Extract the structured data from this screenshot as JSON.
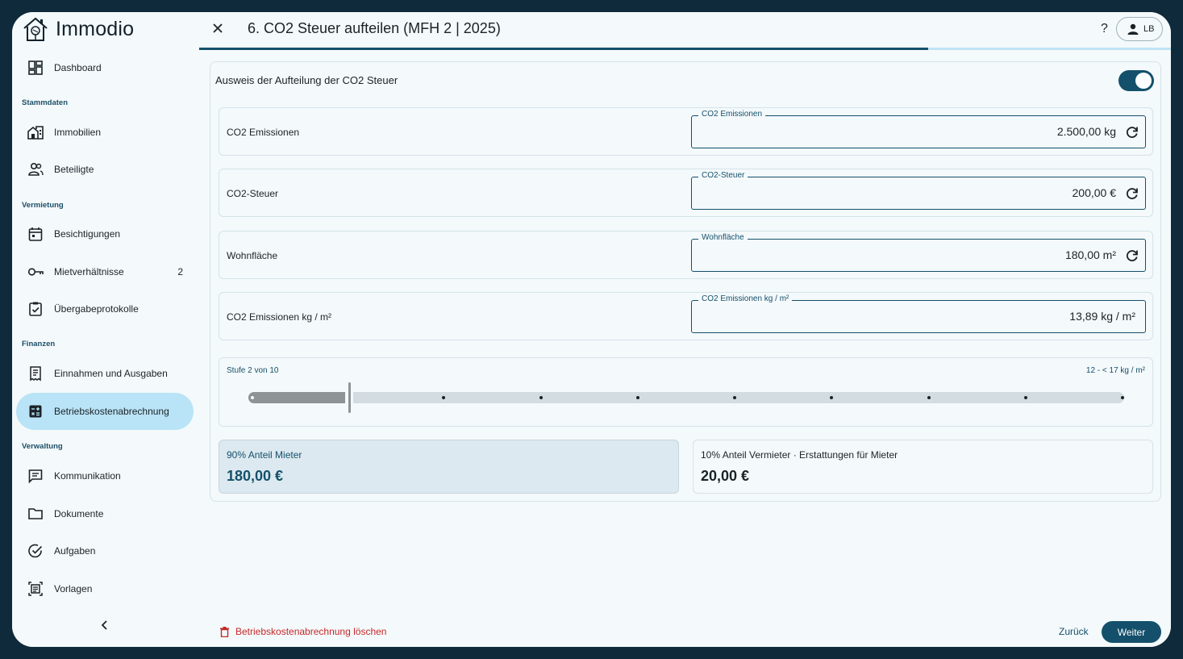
{
  "app": {
    "name": "Immodio"
  },
  "sidebar": {
    "dashboard": "Dashboard",
    "sections": {
      "stammdaten": "Stammdaten",
      "vermietung": "Vermietung",
      "finanzen": "Finanzen",
      "verwaltung": "Verwaltung"
    },
    "items": {
      "immobilien": "Immobilien",
      "beteiligte": "Beteiligte",
      "besichtigungen": "Besichtigungen",
      "mietverhaeltnisse": "Mietverhältnisse",
      "mietverhaeltnisse_count": "2",
      "uebergabeprotokolle": "Übergabeprotokolle",
      "einnahmen": "Einnahmen und Ausgaben",
      "betriebskosten": "Betriebskostenabrechnung",
      "kommunikation": "Kommunikation",
      "dokumente": "Dokumente",
      "aufgaben": "Aufgaben",
      "vorlagen": "Vorlagen"
    },
    "active": "betriebskosten"
  },
  "header": {
    "title": "6. CO2 Steuer aufteilen (MFH 2 | 2025)",
    "help": "?",
    "user_initials": "LB",
    "progress": 0.75
  },
  "form": {
    "toggle_label": "Ausweis der Aufteilung der CO2 Steuer",
    "toggle_on": true,
    "rows": [
      {
        "label": "CO2 Emissionen",
        "field_label": "CO2 Emissionen",
        "value": "2.500,00 kg",
        "resettable": true
      },
      {
        "label": "CO2-Steuer",
        "field_label": "CO2-Steuer",
        "value": "200,00 €",
        "resettable": true
      },
      {
        "label": "Wohnfläche",
        "field_label": "Wohnfläche",
        "value": "180,00 m²",
        "resettable": true
      },
      {
        "label": "CO2 Emissionen kg / m²",
        "field_label": "CO2 Emissionen kg / m²",
        "value": "13,89 kg / m²",
        "resettable": false
      }
    ],
    "slider": {
      "stage_label": "Stufe 2 von 10",
      "range_label": "12 - < 17 kg / m²",
      "current_stage": 2,
      "stages": 10
    },
    "shares": {
      "tenant_label": "90% Anteil Mieter",
      "tenant_value": "180,00 €",
      "landlord_label": "10% Anteil Vermieter · Erstattungen für Mieter",
      "landlord_value": "20,00 €"
    }
  },
  "footer": {
    "delete_label": "Betriebskostenabrechnung löschen",
    "back_label": "Zurück",
    "next_label": "Weiter"
  },
  "colors": {
    "primary": "#14506b",
    "active_nav": "#b9e3f6",
    "danger": "#c62828",
    "background": "#f4f9fb"
  }
}
